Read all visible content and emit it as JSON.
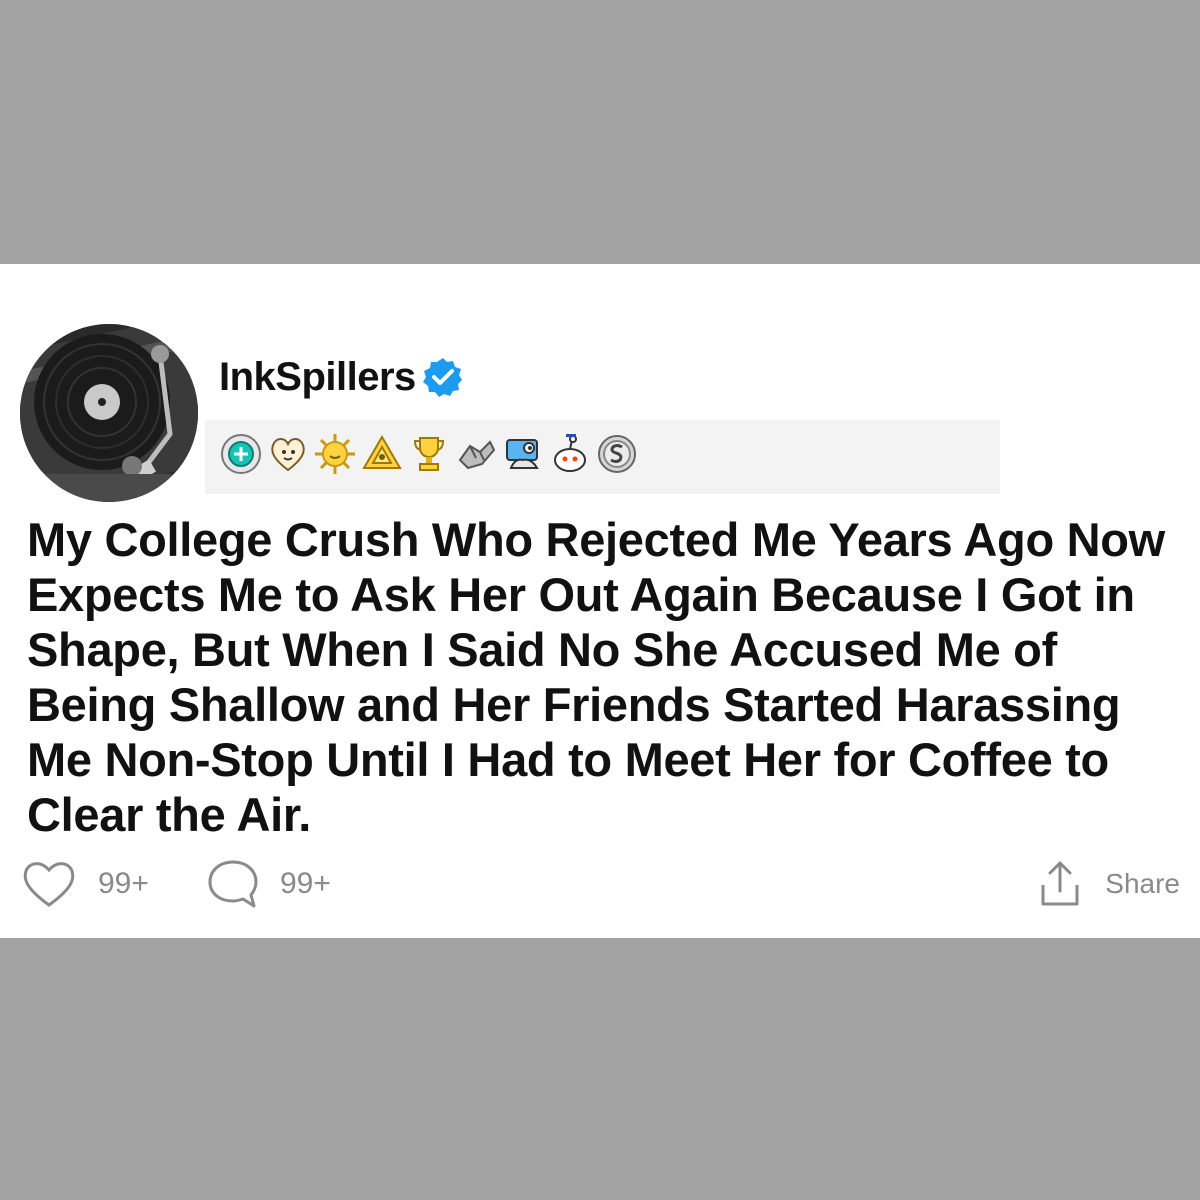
{
  "post": {
    "username": "InkSpillers",
    "verified": true,
    "title": "My College Crush Who Rejected Me Years Ago Now Expects Me to Ask Her Out Again Because I Got in Shape, But When I Said No She Accused Me of Being Shallow and Her Friends Started Harassing Me Non-Stop Until I Had to Meet Her for Coffee to Clear the Air.",
    "awards": [
      {
        "icon": "helpful-award-icon"
      },
      {
        "icon": "wholesome-heart-award-icon"
      },
      {
        "icon": "sun-award-icon"
      },
      {
        "icon": "triangle-award-icon"
      },
      {
        "icon": "trophy-award-icon"
      },
      {
        "icon": "respect-award-icon"
      },
      {
        "icon": "pigeon-award-icon"
      },
      {
        "icon": "snoo-award-icon"
      },
      {
        "icon": "silver-coin-award-icon"
      }
    ]
  },
  "actions": {
    "likes": "99+",
    "comments": "99+",
    "share_label": "Share"
  },
  "colors": {
    "background": "#a3a3a3",
    "card": "#ffffff",
    "verified": "#1d9bf0",
    "muted": "#8a8a8a",
    "award_strip": "#f3f3f3"
  }
}
